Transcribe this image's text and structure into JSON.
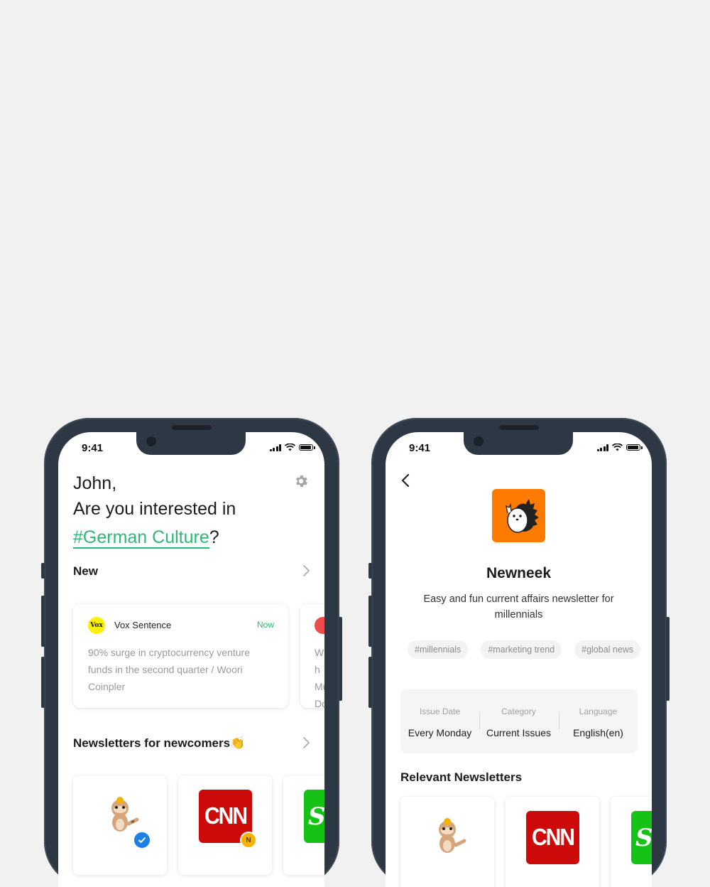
{
  "status_bar": {
    "time": "9:41"
  },
  "home_screen": {
    "greeting_name": "John,",
    "greeting_question": "Are you interested in",
    "interest_tag": "#German Culture",
    "interest_suffix": "?",
    "settings_icon": "gear-icon",
    "new_section": {
      "title": "New",
      "cards": [
        {
          "source": "Vox Sentence",
          "logo_text": "Vox",
          "time": "Now",
          "text": "90% surge in cryptocurrency venture funds in the second quarter / Woori Coinpler"
        },
        {
          "text_peek": "Wh Mu Do"
        }
      ]
    },
    "newcomers_section": {
      "title": "Newsletters for newcomers👏",
      "tiles": [
        {
          "logo": "raccoon-mascot",
          "badge": "check"
        },
        {
          "logo_text": "CNN",
          "badge": "N"
        },
        {
          "logo_text": "S"
        }
      ]
    }
  },
  "detail_screen": {
    "title": "Newneek",
    "description": "Easy and fun current affairs newsletter for millennials",
    "tags": [
      "#millennials",
      "#marketing trend",
      "#global news"
    ],
    "info": [
      {
        "label": "Issue Date",
        "value": "Every Monday"
      },
      {
        "label": "Category",
        "value": "Current Issues"
      },
      {
        "label": "Language",
        "value": "English(en)"
      }
    ],
    "relevant_title": "Relevant Newsletters",
    "relevant_tiles": [
      {
        "logo": "raccoon-mascot"
      },
      {
        "logo_text": "CNN"
      },
      {
        "logo_text": "S"
      }
    ]
  },
  "colors": {
    "accent_green": "#2fb876",
    "phone_frame": "#2e3844",
    "background": "#f1f1f1",
    "newneek_orange": "#ff7a00",
    "cnn_red": "#cc0a0a"
  }
}
